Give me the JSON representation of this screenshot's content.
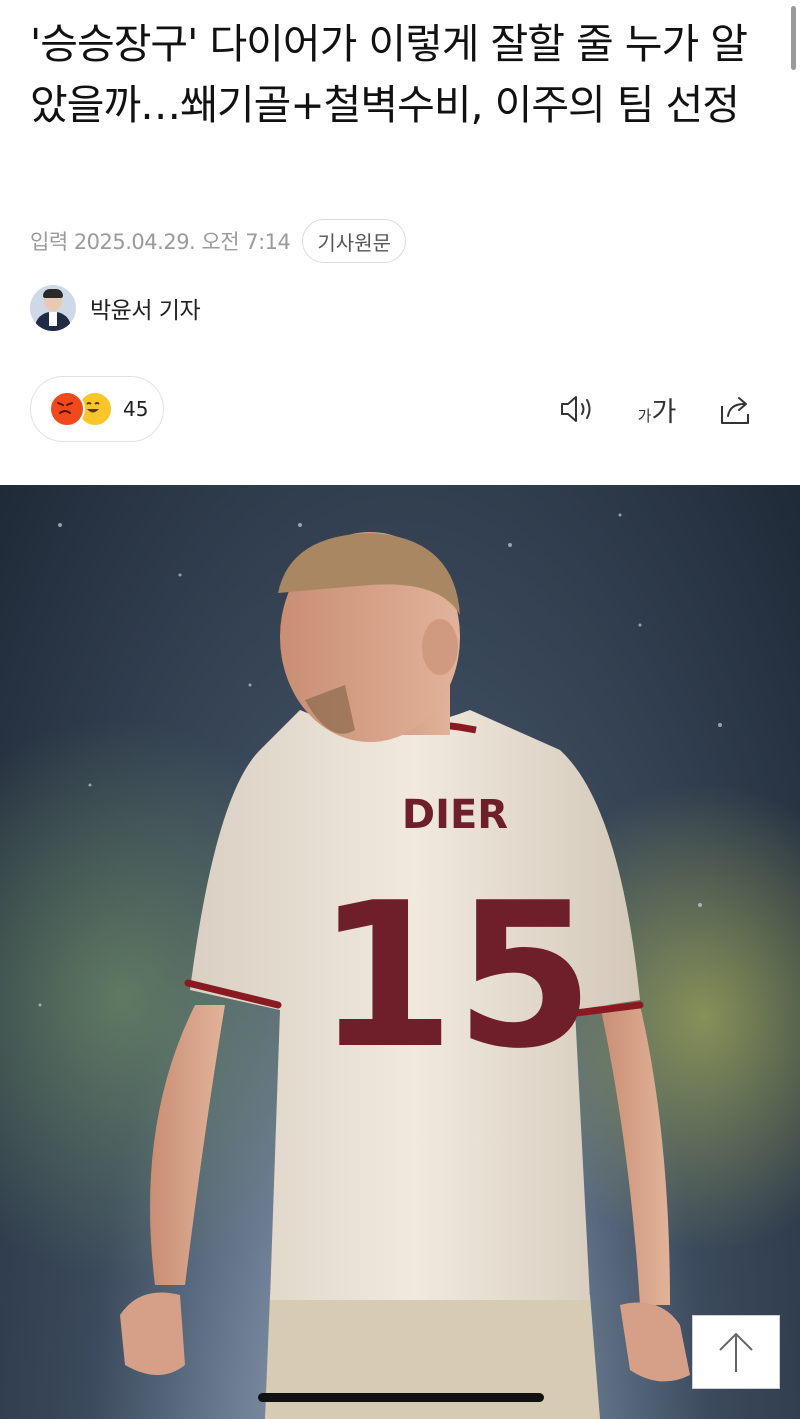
{
  "article": {
    "headline": "'승승장구' 다이어가 이렇게 잘할 줄 누가 알았을까…쐐기골+철벽수비, 이주의 팀 선정",
    "date": "입력 2025.04.29. 오전 7:14",
    "source_button": "기사원문"
  },
  "author": {
    "name": "박윤서 기자"
  },
  "reactions": {
    "count": "45"
  },
  "toolbar": {
    "font_small": "가",
    "font_large": "가"
  },
  "photo": {
    "jersey_name": "DIER",
    "jersey_number": "15"
  },
  "icons": [
    "angry-emoji-icon",
    "laugh-emoji-icon",
    "speaker-icon",
    "font-size-icon",
    "share-icon",
    "arrow-up-icon"
  ],
  "colors": {
    "jersey": "#efe6da",
    "jersey_trim": "#8a1a22",
    "number": "#6e1f2a",
    "background": "#ffffff"
  }
}
